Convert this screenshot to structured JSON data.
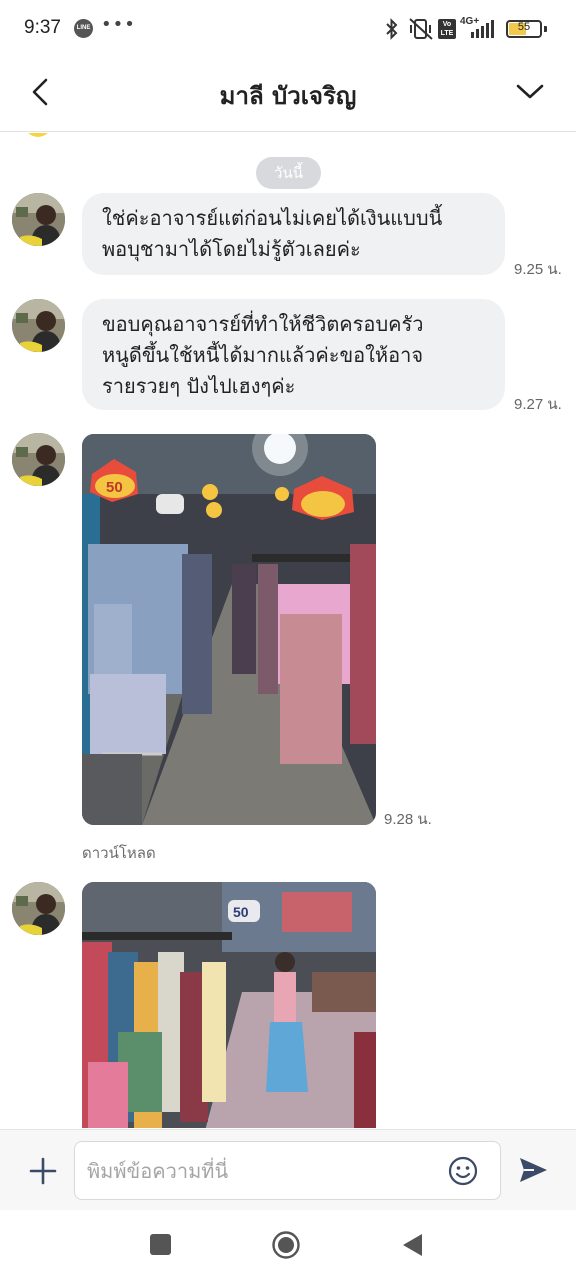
{
  "status_bar": {
    "time": "9:37",
    "line_icon_label": "LINE",
    "more_dots": "•••",
    "network_label": "4G+",
    "volte_label": "Vo LTE",
    "battery_percent": 55,
    "battery_label": "55",
    "icons": [
      "bluetooth-icon",
      "vibrate-off-icon",
      "volte-icon",
      "signal-icon",
      "battery-icon"
    ]
  },
  "header": {
    "title": "มาลี บัวเจริญ",
    "back_icon": "chevron-left-icon",
    "menu_icon": "chevron-down-icon"
  },
  "chat": {
    "date_divider": "วันนี้",
    "messages": [
      {
        "type": "text",
        "line1": "ใช่ค่ะอาจารย์แต่ก่อนไม่เคยได้เงินแบบนี้",
        "line2": "พอบุชามาได้โดยไม่รู้ตัวเลยค่ะ",
        "time": "9.25 น."
      },
      {
        "type": "text",
        "line1": "ขอบคุณอาจารย์ที่ทำให้ชีวิตครอบครัว",
        "line2": "หนูดีขึ้นใช้หนี้ได้มากแล้วค่ะขอให้อาจ",
        "line3": "รายรวยๆ ปังไปเฮงๆค่ะ",
        "time": "9.27 น."
      },
      {
        "type": "image",
        "sign_text": "50",
        "time": "9.28 น.",
        "download_label": "ดาวน์โหลด"
      },
      {
        "type": "image",
        "sign_text": "50"
      }
    ]
  },
  "input_bar": {
    "placeholder": "พิมพ์ข้อความที่นี่",
    "plus_icon": "plus-icon",
    "emoji_icon": "smiley-icon",
    "send_icon": "send-icon"
  },
  "nav_bar": {
    "icons": [
      "recent-apps-icon",
      "home-icon",
      "back-icon"
    ]
  },
  "colors": {
    "bubble_bg": "#f0f1f3",
    "date_chip_bg": "#d7d9dc",
    "accent": "#3c4a69",
    "battery": "#f2c94c"
  }
}
